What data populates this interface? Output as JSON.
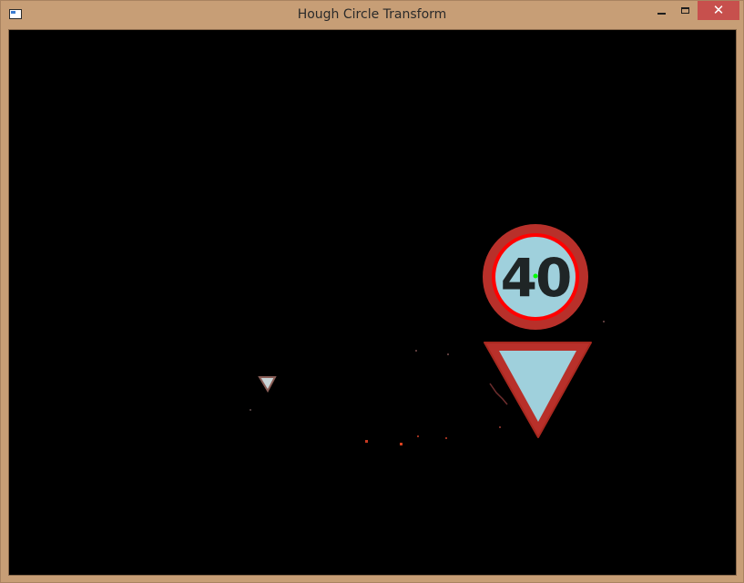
{
  "window": {
    "title": "Hough Circle Transform",
    "controls": {
      "minimize": "minimize-icon",
      "maximize": "maximize-icon",
      "close": "✕"
    }
  },
  "image": {
    "speed_sign_text": "40",
    "colors": {
      "background": "#000000",
      "sign_red": "#b8302a",
      "sign_face": "#9fd0dc",
      "digits": "#1f2526",
      "detected_circle": "#ff0000",
      "detected_center": "#00ff00"
    }
  }
}
